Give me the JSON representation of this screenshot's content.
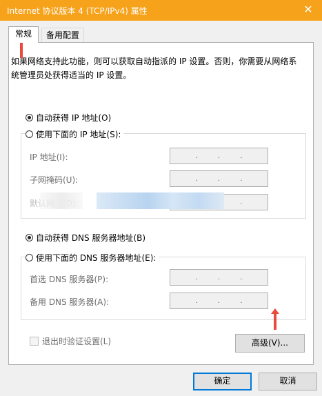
{
  "window": {
    "title": "Internet 协议版本 4 (TCP/IPv4) 属性",
    "close_glyph": "✕"
  },
  "tabs": [
    {
      "label": "常规",
      "active": true
    },
    {
      "label": "备用配置",
      "active": false
    }
  ],
  "description": "如果网络支持此功能，则可以获取自动指派的 IP 设置。否则，你需要从网络系统管理员处获得适当的 IP 设置。",
  "ip_section": {
    "auto_label": "自动获得 IP 地址(O)",
    "auto_selected": true,
    "manual_label": "使用下面的 IP 地址(S):",
    "manual_selected": false,
    "fields": [
      {
        "label": "IP 地址(I):",
        "dots": ".    .    ."
      },
      {
        "label": "子网掩码(U):",
        "dots": ".    .    ."
      },
      {
        "label": "默认网关(D):",
        "dots": ".    .    ."
      }
    ]
  },
  "dns_section": {
    "auto_label": "自动获得 DNS 服务器地址(B)",
    "auto_selected": true,
    "manual_label": "使用下面的 DNS 服务器地址(E):",
    "manual_selected": false,
    "fields": [
      {
        "label": "首选 DNS 服务器(P):",
        "dots": ".    .    ."
      },
      {
        "label": "备用 DNS 服务器(A):",
        "dots": ".    .    ."
      }
    ]
  },
  "validate_checkbox": {
    "label": "退出时验证设置(L)",
    "checked": false
  },
  "buttons": {
    "advanced": "高级(V)...",
    "ok": "确定",
    "cancel": "取消"
  },
  "annotation_color": "#e84b3c",
  "title_color": "#f6a21a"
}
